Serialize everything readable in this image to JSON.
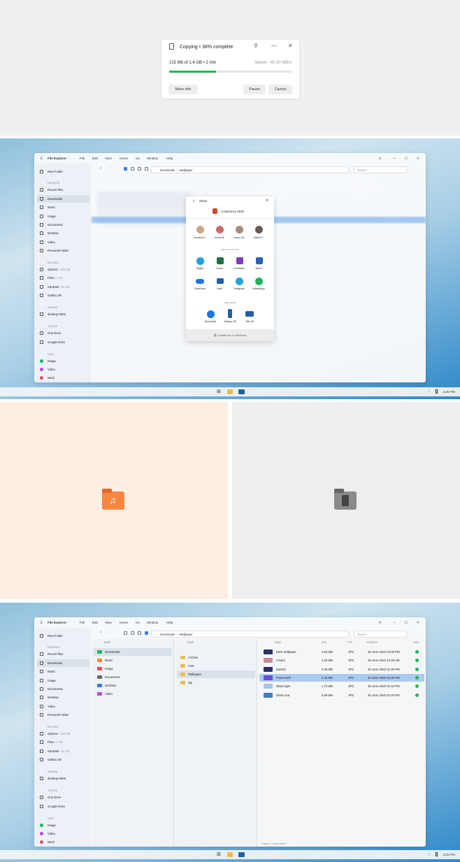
{
  "copy_dialog": {
    "title": "Copying • 38% complete",
    "size_text": "215 Mb of 1.4 GB • 2 min",
    "speed_text": "Speed - 40.20 MB/s",
    "progress": 0.38,
    "more_info": "More info",
    "pause": "Pause",
    "cancel": "Cancel",
    "pin": "⚲",
    "minimize": "—",
    "close": "✕",
    "accent": "#1fb55a"
  },
  "window": {
    "app_title": "File Explorer",
    "menu": [
      "File",
      "Edit",
      "View",
      "Home",
      "Go",
      "Window",
      "Help"
    ],
    "search_placeholder": "Search",
    "breadcrumb": [
      "Downloads",
      "Wallpaper"
    ],
    "min": "—",
    "max": "☐",
    "close": "✕"
  },
  "sidebar": {
    "new_folder": "New Folder",
    "favorites_header": "FAVORITE",
    "favorites": [
      "Recent files",
      "Downloads",
      "Music",
      "Image",
      "Documents",
      "Desktop",
      "Video",
      "Personal Folder"
    ],
    "devices_header": "DEVICES",
    "devices": [
      {
        "name": "System",
        "meta": "• 128 Gb"
      },
      {
        "name": "Files",
        "meta": "• 1 Tb"
      },
      {
        "name": "SanDisk",
        "meta": "• 32 Gb"
      },
      {
        "name": "Galaxy S8",
        "meta": ""
      }
    ],
    "shared_header": "SHARED",
    "shared": [
      "desktop-0825"
    ],
    "cloud_header": "CLOUDS",
    "cloud": [
      "One Drive",
      "Google Drive"
    ],
    "tags_header": "TAGS",
    "tags": [
      {
        "name": "Image",
        "color": "#1fb55a"
      },
      {
        "name": "Video",
        "color": "#b84bd6"
      },
      {
        "name": "Work",
        "color": "#e84a5f"
      }
    ]
  },
  "share": {
    "title": "Share",
    "file": "Conference 2020",
    "contacts": [
      "Jessica K.",
      "Gloria B.",
      "Jenny W.",
      "Albert F."
    ],
    "apps_header": "SELECT AN APP",
    "apps": [
      "Skype",
      "Excel",
      "OneNote",
      "Word",
      "OneDrive",
      "Mail",
      "Telegram",
      "WhatsApp"
    ],
    "send_header": "AND SEND",
    "devices": [
      "Bluetooth",
      "Galaxy S8",
      "Tab S6"
    ],
    "link": "Create link in OneDrive"
  },
  "taskbar": {
    "time": "5:25 PM"
  },
  "columns": {
    "name_header": "NAME",
    "folders1": [
      "Downloads",
      "Music",
      "Image",
      "Documents",
      "Desktop",
      "Video"
    ],
    "folders2": [
      "Archive",
      "Font",
      "Wallpaper",
      "Zip"
    ],
    "headers": [
      "NAME",
      "SIZE",
      "TYPE",
      "CHANGED",
      "TAGS"
    ],
    "files": [
      {
        "name": "Dark wallpaper",
        "size": "3.63 MB",
        "type": "JPG",
        "changed": "28 June 2020 03:35 PM"
      },
      {
        "name": "Cream",
        "size": "2.23 MB",
        "type": "JPG",
        "changed": "28 June 2020 12:35 AM"
      },
      {
        "name": "Dark32",
        "size": "2.83 MB",
        "type": "JPG",
        "changed": "25 June 2020 01:45 PM"
      },
      {
        "name": "Fluent wall",
        "size": "2.45 MB",
        "type": "JPG",
        "changed": "26 June 2020 01:30 PM"
      },
      {
        "name": "Glass light",
        "size": "1.70 MB",
        "type": "JPG",
        "changed": "25 June 2020 01:42 PM"
      },
      {
        "name": "Glass sea",
        "size": "5.89 MB",
        "type": "JPG",
        "changed": "26 June 2020 01:40 PM"
      }
    ],
    "status": "6 items • 1 items select"
  }
}
